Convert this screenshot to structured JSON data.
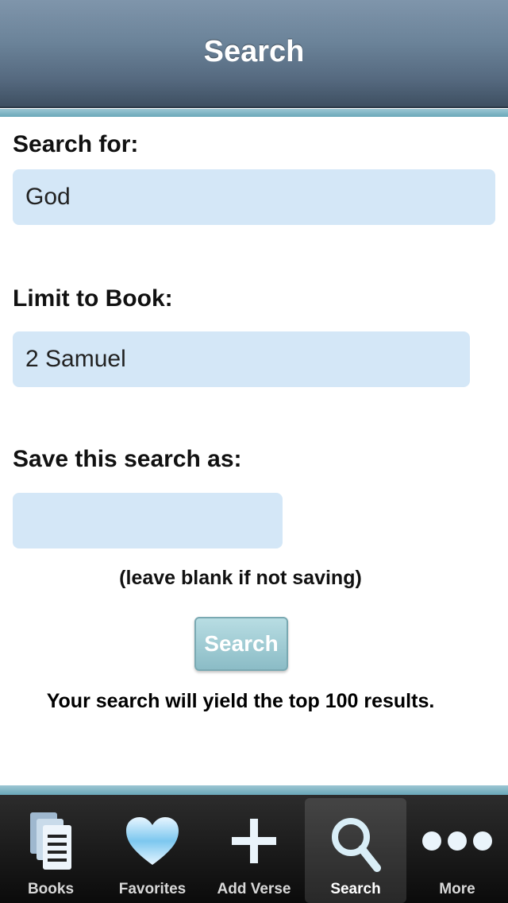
{
  "navbar": {
    "title": "Search"
  },
  "form": {
    "search_label": "Search for:",
    "search_value": "God",
    "book_label": "Limit to Book:",
    "book_value": "2 Samuel",
    "save_label": "Save this search as:",
    "save_value": "",
    "save_hint": "(leave blank if not saving)",
    "search_button": "Search",
    "footer_note": "Your search will yield the top 100 results."
  },
  "tabbar": {
    "items": [
      {
        "label": "Books",
        "icon": "books-icon"
      },
      {
        "label": "Favorites",
        "icon": "heart-icon"
      },
      {
        "label": "Add Verse",
        "icon": "plus-icon"
      },
      {
        "label": "Search",
        "icon": "search-icon",
        "active": true
      },
      {
        "label": "More",
        "icon": "more-icon"
      }
    ]
  },
  "colors": {
    "accent": "#8bbcc6",
    "field_bg": "#d4e7f7",
    "navbar": "#55697f"
  }
}
